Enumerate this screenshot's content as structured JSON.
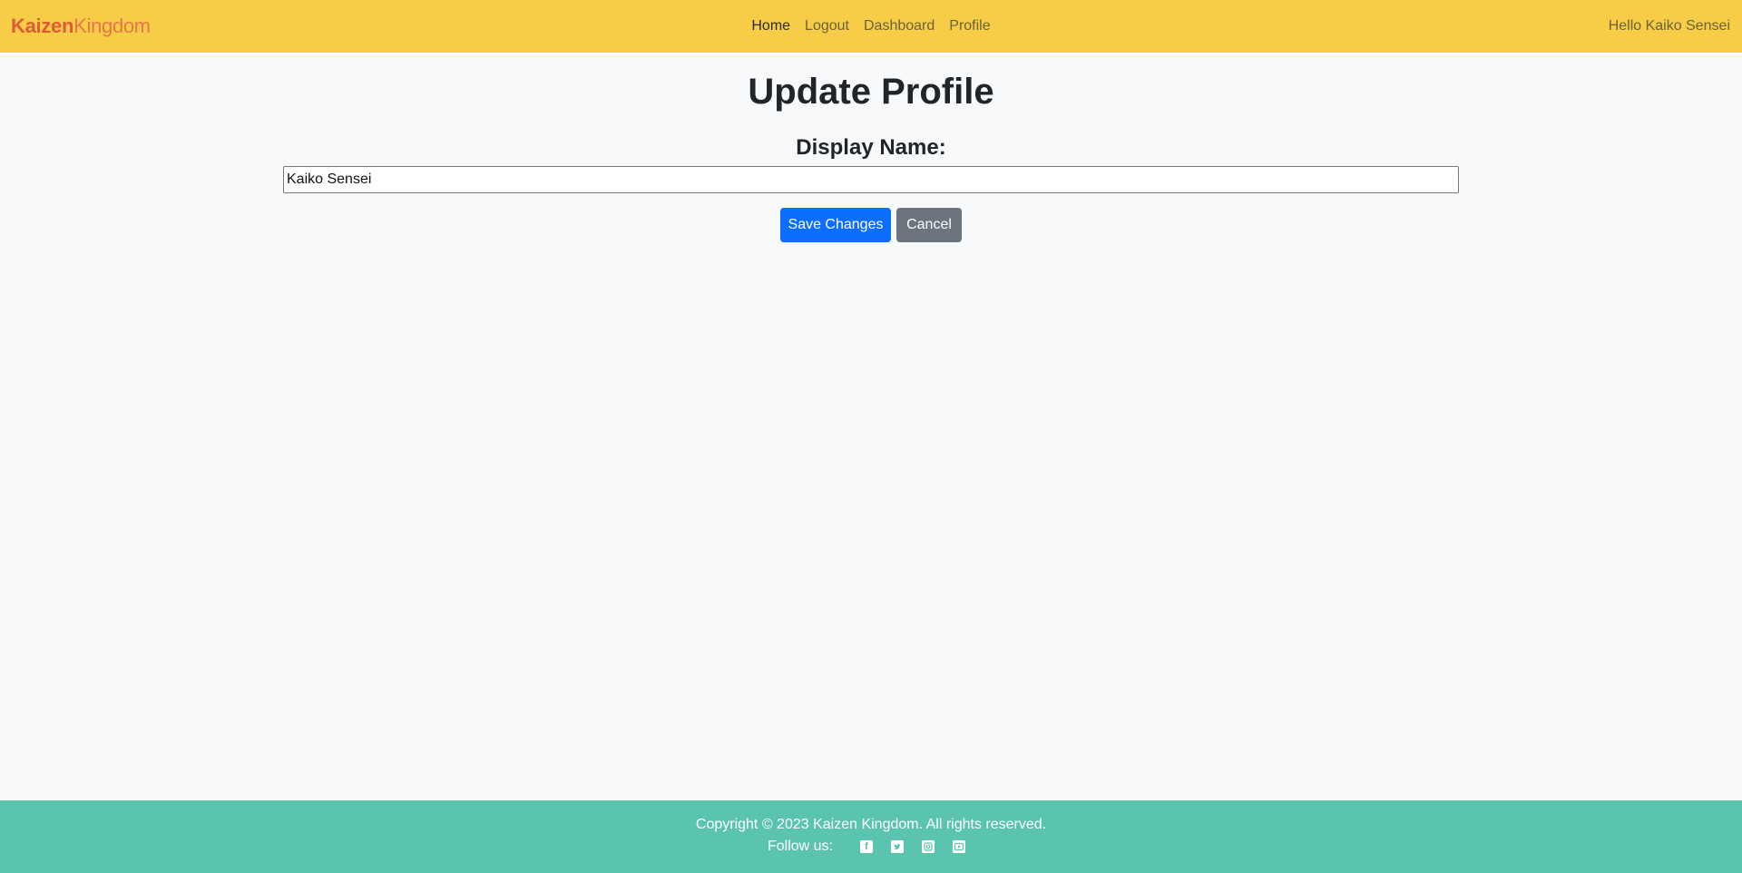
{
  "nav": {
    "brand_part1": "Kaizen",
    "brand_part2": "Kingdom",
    "links": [
      {
        "label": "Home"
      },
      {
        "label": "Logout"
      },
      {
        "label": "Dashboard"
      },
      {
        "label": "Profile"
      }
    ],
    "greeting": "Hello Kaiko Sensei"
  },
  "main": {
    "title": "Update Profile",
    "display_name_label": "Display Name:",
    "display_name_value": "Kaiko Sensei",
    "save_label": "Save Changes",
    "cancel_label": "Cancel"
  },
  "footer": {
    "copyright": "Copyright © 2023 Kaizen Kingdom. All rights reserved.",
    "follow_label": "Follow us:",
    "social_icons": [
      "facebook-icon",
      "twitter-icon",
      "instagram-icon",
      "youtube-icon"
    ]
  },
  "colors": {
    "navbar": "#f7cd48",
    "footer": "#5ac4ae",
    "primary": "#0d6efd",
    "secondary": "#6c757d"
  }
}
